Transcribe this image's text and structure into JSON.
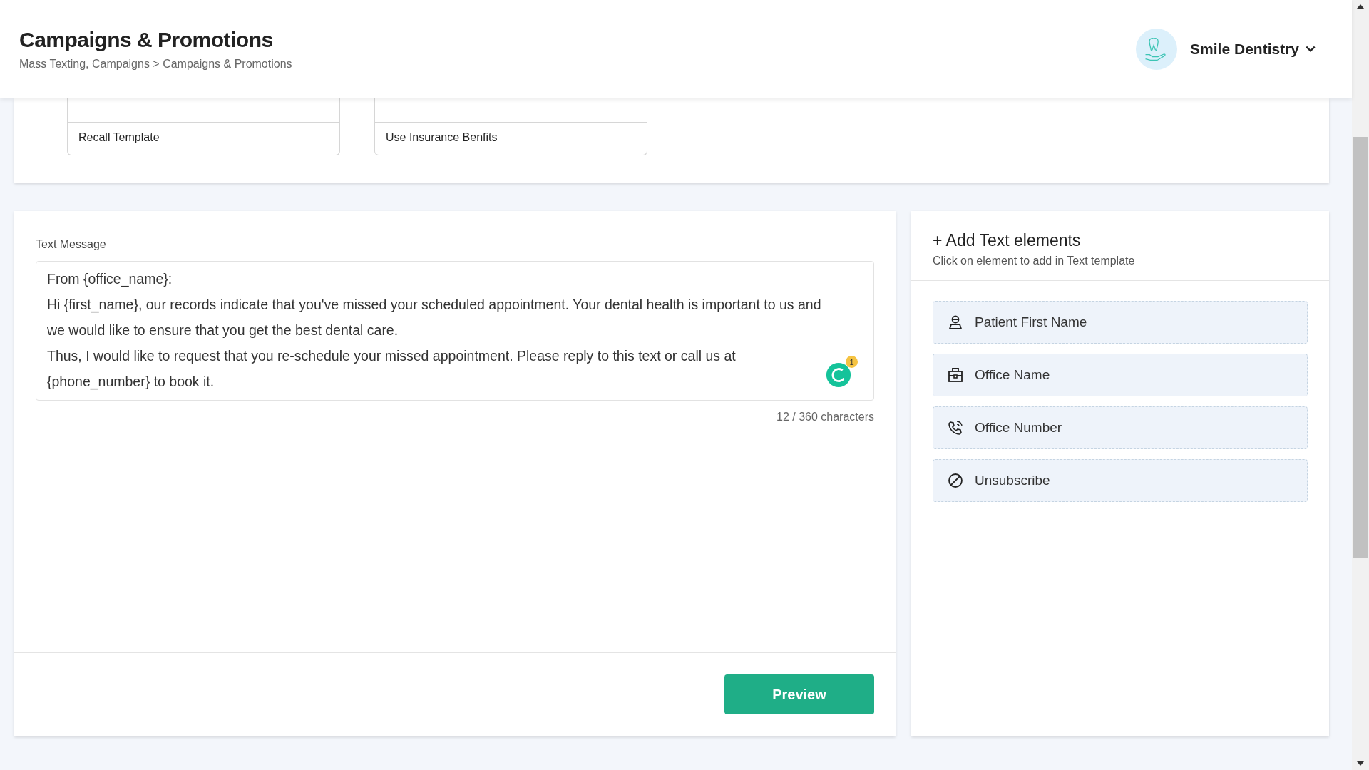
{
  "header": {
    "title": "Campaigns & Promotions",
    "breadcrumb": "Mass Texting, Campaigns > Campaigns & Promotions",
    "account": {
      "name": "Smile Dentistry"
    }
  },
  "templates": [
    {
      "name": "Recall Template"
    },
    {
      "name": "Use Insurance Benfits"
    }
  ],
  "message": {
    "label": "Text Message",
    "lines": [
      "From {office_name}:",
      "Hi {first_name}, our records indicate that you've missed your scheduled appointment. Your dental health is important to us and we would like to ensure that you get the best dental care.",
      "Thus, I would like to request that you re-schedule your missed appointment. Please reply to this text or call us at {phone_number} to book it."
    ],
    "assistant_count": "1",
    "counter": "12 / 360 characters",
    "button": "Preview"
  },
  "elements": {
    "title": "+ Add Text elements",
    "subtitle": "Click on element to add in Text template",
    "items": [
      {
        "kind": "person",
        "label": "Patient First Name"
      },
      {
        "kind": "office",
        "label": "Office Name"
      },
      {
        "kind": "phone",
        "label": "Office Number"
      },
      {
        "kind": "block",
        "label": "Unsubscribe"
      }
    ]
  }
}
